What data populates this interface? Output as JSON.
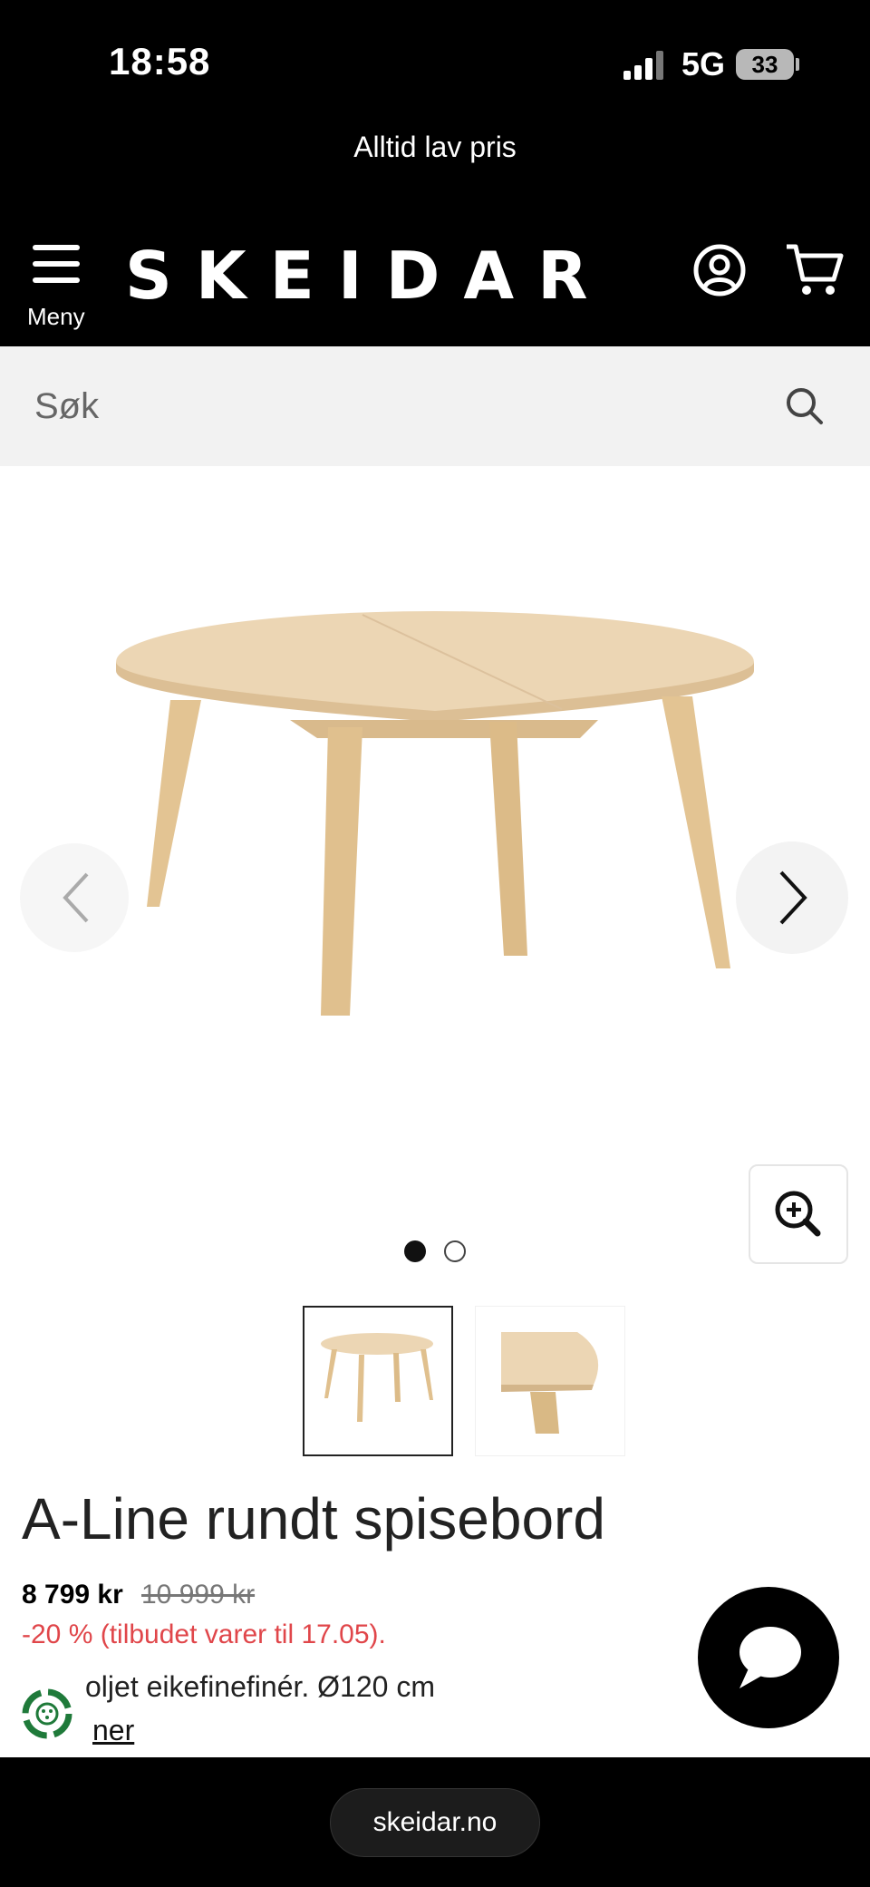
{
  "status_bar": {
    "time": "18:58",
    "network": "5G",
    "battery": "33",
    "signal_icon": "signal-bars-icon",
    "battery_icon": "battery-icon"
  },
  "promo": {
    "text": "Alltid lav pris"
  },
  "header": {
    "menu_label": "Meny",
    "logo": "SKEIDAR",
    "menu_icon": "hamburger-icon",
    "account_icon": "user-account-icon",
    "cart_icon": "shopping-cart-icon"
  },
  "search": {
    "placeholder": "Søk",
    "value": "",
    "icon": "search-icon"
  },
  "gallery": {
    "prev_icon": "chevron-left-icon",
    "next_icon": "chevron-right-icon",
    "zoom_icon": "zoom-in-icon",
    "image_count": 2,
    "active_index": 1
  },
  "product": {
    "title": "A-Line rundt spisebord",
    "price": "8 799 kr",
    "old_price": "10 999 kr",
    "discount": "-20 % (tilbudet varer til 17.05).",
    "description": "oljet eikefinefinér. Ø120 cm",
    "more_link": "ner"
  },
  "chat": {
    "icon": "chat-bubble-icon"
  },
  "eco_badge": {
    "icon": "eco-recycle-icon"
  },
  "browser": {
    "url": "skeidar.no"
  },
  "colors": {
    "background_dark": "#000000",
    "discount_red": "#e0464a",
    "search_bg": "#f2f2f2",
    "wood": "#e8cfa8"
  }
}
